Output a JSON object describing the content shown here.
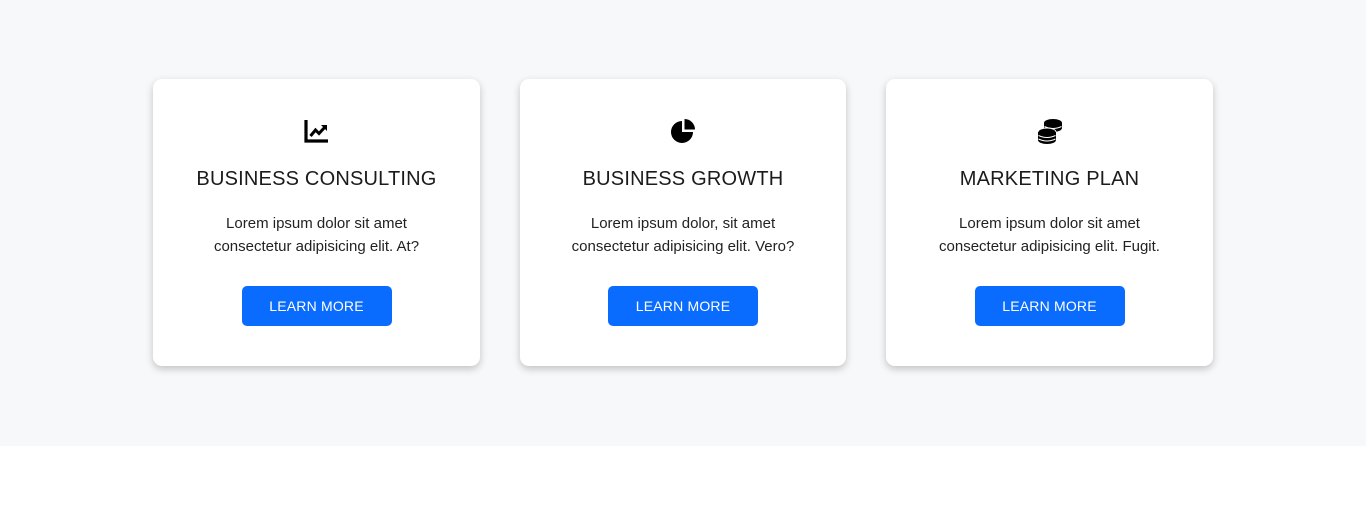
{
  "cards": [
    {
      "icon": "chart-line-icon",
      "title": "BUSINESS CONSULTING",
      "description": "Lorem ipsum dolor sit amet consectetur adipisicing elit. At?",
      "button_label": "LEARN MORE"
    },
    {
      "icon": "pie-chart-icon",
      "title": "BUSINESS GROWTH",
      "description": "Lorem ipsum dolor, sit amet consectetur adipisicing elit. Vero?",
      "button_label": "LEARN MORE"
    },
    {
      "icon": "coins-icon",
      "title": "MARKETING PLAN",
      "description": "Lorem ipsum dolor sit amet consectetur adipisicing elit. Fugit.",
      "button_label": "LEARN MORE"
    }
  ],
  "colors": {
    "accent": "#0a6cff",
    "section_background": "#f7f8fa",
    "card_background": "#ffffff"
  }
}
